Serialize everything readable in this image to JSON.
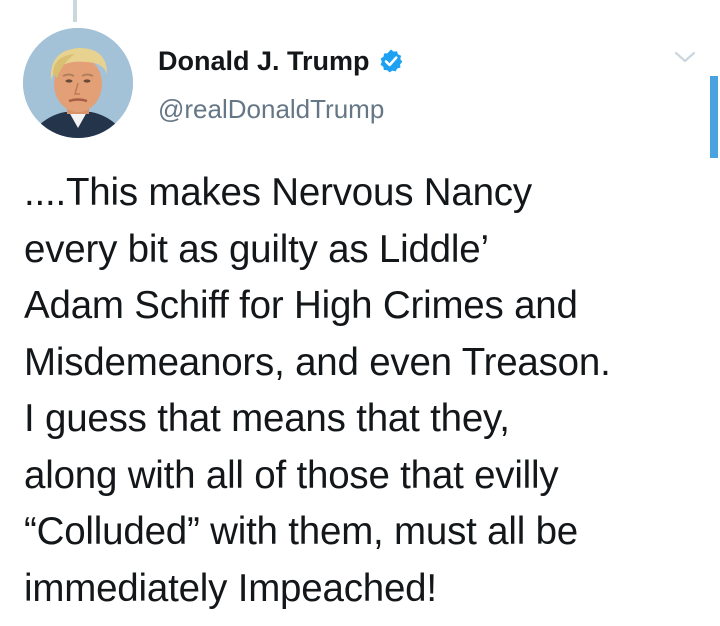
{
  "tweet": {
    "author_name": "Donald J. Trump",
    "handle": "@realDonaldTrump",
    "verified": true,
    "text": "....This makes Nervous Nancy\nevery bit as guilty as Liddle’\nAdam Schiff for High Crimes and\nMisdemeanors, and even Treason.\nI guess that means that they,\nalong with all of those that evilly\n“Colluded” with them, must all be\nimmediately Impeached!"
  },
  "icons": {
    "verified": "verified-badge-icon",
    "menu": "chevron-down-icon",
    "avatar": "profile-photo"
  },
  "colors": {
    "name": "#14171a",
    "handle": "#657786",
    "verified": "#1da1f2",
    "caret": "#ccd6dd",
    "thread_line": "#ccd6dd",
    "scrollbar": "#4aa3df"
  }
}
